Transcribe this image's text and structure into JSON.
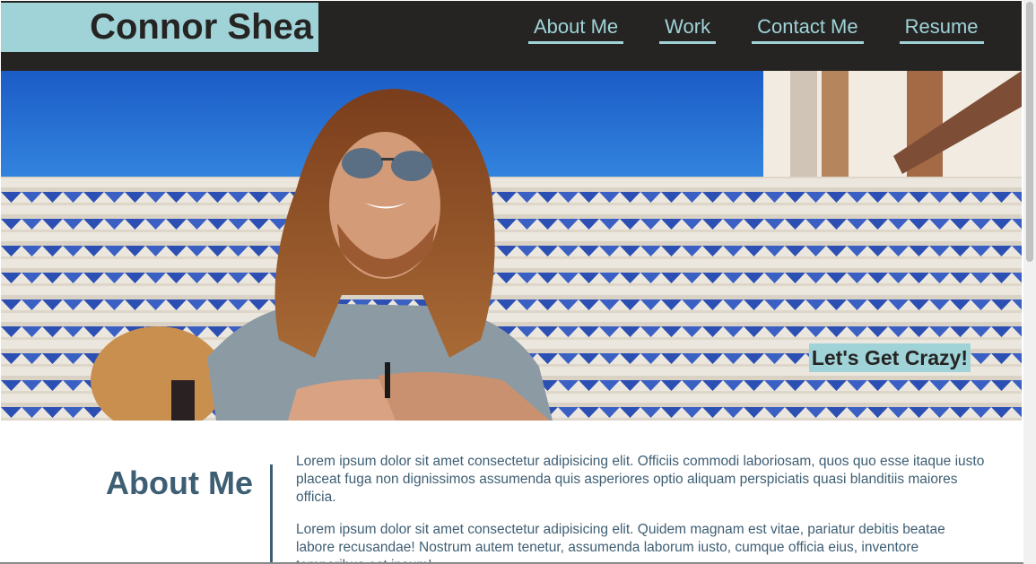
{
  "header": {
    "brand_name": "Connor Shea",
    "nav": [
      "About Me",
      "Work",
      "Contact Me",
      "Resume"
    ]
  },
  "hero": {
    "tagline": "Let's Get Crazy!"
  },
  "about": {
    "heading": "About Me",
    "paragraphs": [
      "Lorem ipsum dolor sit amet consectetur adipisicing elit. Officiis commodi laboriosam, quos quo esse itaque iusto placeat fuga non dignissimos assumenda quis asperiores optio aliquam perspiciatis quasi blanditiis maiores officia.",
      "Lorem ipsum dolor sit amet consectetur adipisicing elit. Quidem magnam est vitae, pariatur debitis beatae labore recusandae! Nostrum autem tenetur, assumenda laborum iusto, cumque officia eius, inventore temporibus est ipsum!"
    ]
  },
  "colors": {
    "accent": "#9fd3d8",
    "header_bg": "#252423",
    "text": "#3e5e73"
  }
}
